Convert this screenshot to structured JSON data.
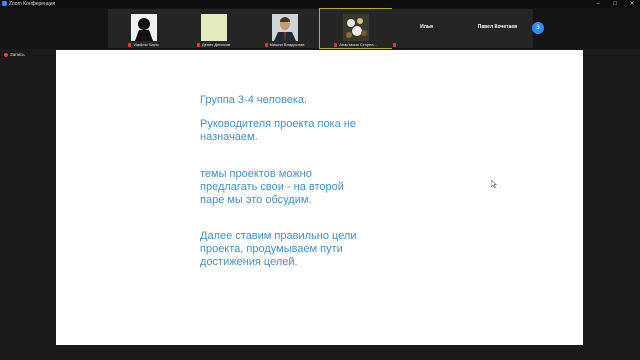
{
  "window": {
    "title": "Zoom Конференция",
    "minimize": "–",
    "maximize": "□",
    "close": "✕"
  },
  "participants": [
    {
      "name": "Vladimir Savic",
      "muted": true
    },
    {
      "name": "Денис Денисов",
      "muted": true
    },
    {
      "name": "Мишин Владислав",
      "muted": true
    },
    {
      "name": "Анастасия Старел...",
      "muted": true,
      "active": true
    },
    {
      "name": "Илья",
      "muted": true
    },
    {
      "name": "Павел Кочетаев",
      "muted": false
    }
  ],
  "next_page": "3",
  "recording": {
    "label": "Запись"
  },
  "slide": {
    "p1": "Группа 3-4 человека.",
    "p2": "Руководителя проекта пока не назначаем.",
    "p3": "темы проектов можно предлагать свои - на второй паре мы это обсудим.",
    "p4": "Далее ставим правильно цели проекта, продумываем пути достижения целей."
  },
  "colors": {
    "slide_text": "#4292c6",
    "active_speaker": "#b4b420",
    "accent": "#2d8cff"
  }
}
